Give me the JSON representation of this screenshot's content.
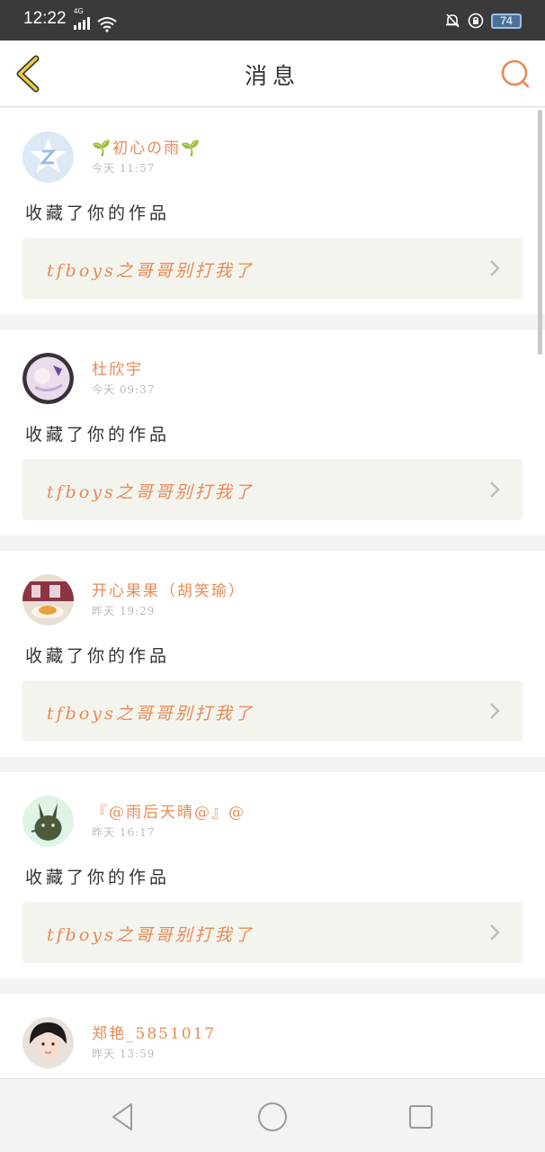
{
  "status_bar": {
    "time": "12:22",
    "network": "4G",
    "battery": "74"
  },
  "header": {
    "title": "消息",
    "icons": {
      "back": "chevron-left-icon",
      "search": "search-icon"
    }
  },
  "messages": [
    {
      "name": "🌱初心の雨🌱",
      "time": "今天 11:57",
      "action": "收藏了你的作品",
      "work_title": "tfboys之哥哥别打我了",
      "avatar": "qq-default-avatar"
    },
    {
      "name": "杜欣宇",
      "time": "今天 09:37",
      "action": "收藏了你的作品",
      "work_title": "tfboys之哥哥别打我了",
      "avatar": "anime-avatar"
    },
    {
      "name": "开心果果（胡笑瑜）",
      "time": "昨天 19:29",
      "action": "收藏了你的作品",
      "work_title": "tfboys之哥哥别打我了",
      "avatar": "cake-avatar"
    },
    {
      "name": "『@雨后天晴@』@",
      "time": "昨天 16:17",
      "action": "收藏了你的作品",
      "work_title": "tfboys之哥哥别打我了",
      "avatar": "bunny-avatar"
    },
    {
      "name": "郑艳_5851017",
      "time": "昨天 13:59",
      "action": "",
      "work_title": "",
      "avatar": "girl-avatar"
    }
  ],
  "colors": {
    "accent": "#e88a55",
    "card_bg": "#f4f4ee",
    "page_bg": "#f3f3f3"
  }
}
